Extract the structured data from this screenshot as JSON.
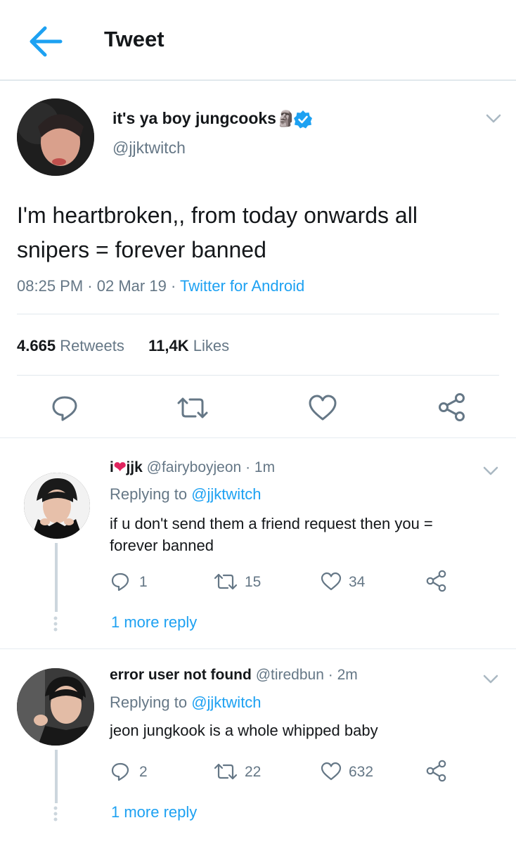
{
  "header": {
    "title": "Tweet",
    "back_icon": "arrow-left-icon"
  },
  "main_tweet": {
    "display_name": "it's ya boy jungcooks",
    "emoji": "🗿",
    "verified_icon": "verified-badge-icon",
    "handle": "@jjktwitch",
    "text_line1": "I'm heartbroken,, from today onwards all",
    "text_line2": "snipers = forever banned",
    "time": "08:25 PM",
    "sep1": "·",
    "date": "02 Mar 19",
    "sep2": "·",
    "source": "Twitter for Android",
    "retweets_count": "4.665",
    "retweets_label": "Retweets",
    "likes_count": "11,4K",
    "likes_label": "Likes"
  },
  "replies": [
    {
      "display_name_prefix": "i",
      "heart": "❤",
      "display_name_suffix": "jjk",
      "handle": "@fairyboyjeon",
      "sep": "·",
      "age": "1m",
      "replying_prefix": "Replying to",
      "replying_handle": "@jjktwitch",
      "text_line1": "if u don't send them a friend request then you =",
      "text_line2": "forever banned",
      "reply_count": "1",
      "retweet_count": "15",
      "like_count": "34",
      "more": "1 more reply"
    },
    {
      "display_name": "error user not found",
      "handle": "@tiredbun",
      "sep": "·",
      "age": "2m",
      "replying_prefix": "Replying to",
      "replying_handle": "@jjktwitch",
      "text_line1": "jeon jungkook is a whole whipped baby",
      "reply_count": "2",
      "retweet_count": "22",
      "like_count": "632",
      "more": "1 more reply"
    }
  ],
  "colors": {
    "accent": "#1da1f2",
    "secondary_text": "#657786",
    "heart": "#e0245e"
  }
}
